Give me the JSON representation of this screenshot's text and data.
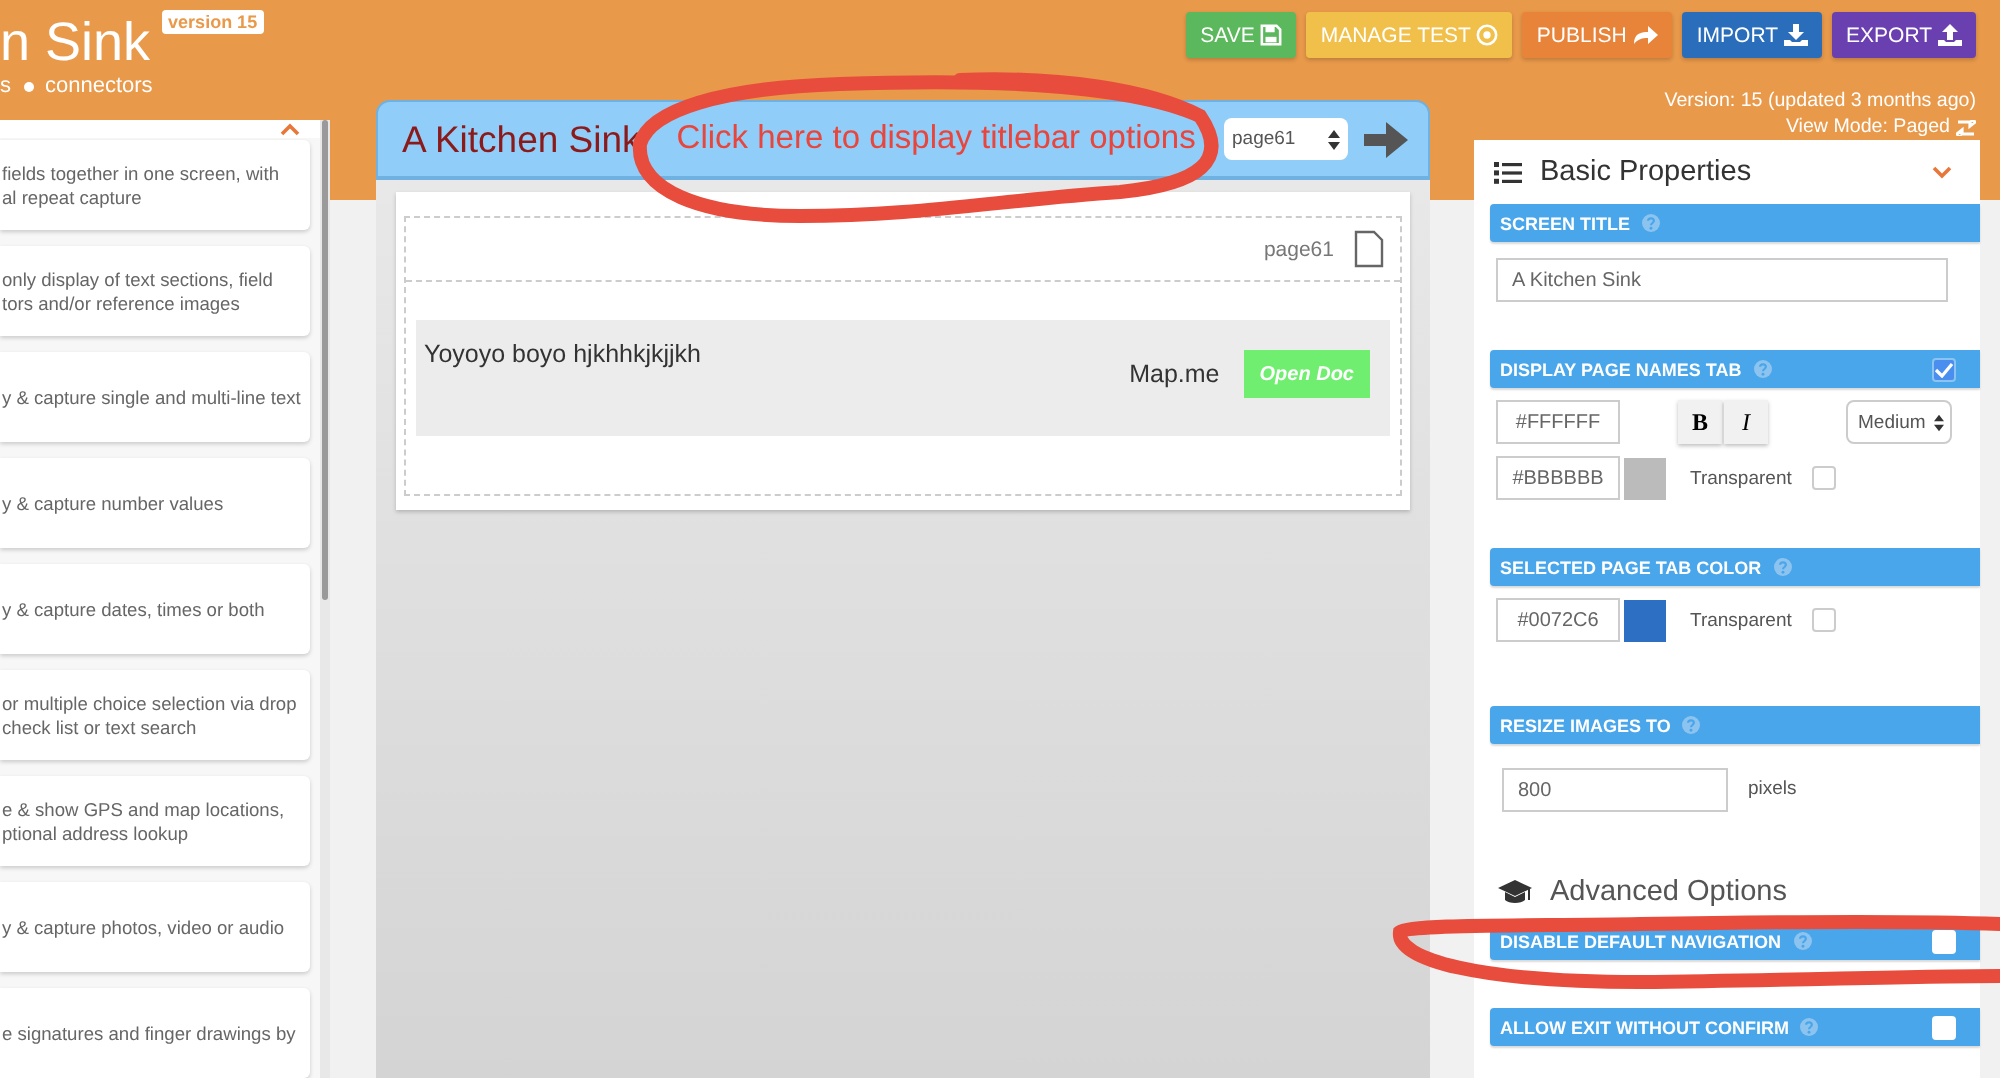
{
  "header": {
    "title": "n Sink",
    "version_badge": "version 15",
    "breadcrumb": [
      {
        "label": "s"
      },
      {
        "label": "connectors"
      }
    ]
  },
  "toolbar": [
    {
      "label": "SAVE",
      "kind": "save",
      "color": "#5cb85c"
    },
    {
      "label": "MANAGE TEST",
      "kind": "target",
      "color": "#f0c04a"
    },
    {
      "label": "PUBLISH",
      "kind": "share",
      "color": "#e8843a"
    },
    {
      "label": "IMPORT",
      "kind": "download",
      "color": "#2a6ebb"
    },
    {
      "label": "EXPORT",
      "kind": "upload",
      "color": "#6a3fb0"
    }
  ],
  "version_info": "Version: 15 (updated 3 months ago)",
  "view_mode": "View Mode: Paged",
  "components_panel": {
    "expanded": true,
    "items": [
      {
        "description": "fields together in one screen, with\nal repeat capture"
      },
      {
        "description": "only display of text sections, field\ntors and/or reference images"
      },
      {
        "description": "y & capture single and multi-line text"
      },
      {
        "description": "y & capture number values"
      },
      {
        "description": "y & capture dates, times or both"
      },
      {
        "description": "or multiple choice selection via drop\ncheck list or text search"
      },
      {
        "description": "e & show GPS and map locations,\nptional address lookup"
      },
      {
        "description": "y & capture photos, video or audio"
      },
      {
        "description": "e signatures and finger drawings by"
      }
    ]
  },
  "screen": {
    "title": "A Kitchen Sink",
    "titlebar_hint": "Click here to display titlebar options",
    "page_select": "page61",
    "page_label": "page61",
    "text": "Yoyoyo boyo hjkhhkjkjjkh",
    "link": "Map.me",
    "button": "Open Doc"
  },
  "properties": {
    "title": "Basic Properties",
    "expanded": true,
    "sections": [
      {
        "kind": "text",
        "label": "SCREEN TITLE",
        "value": "A Kitchen Sink"
      },
      {
        "kind": "page_names",
        "label": "DISPLAY PAGE NAMES TAB",
        "checked": true,
        "text_color": "#FFFFFF",
        "bold": "B",
        "italic": "I",
        "size": "Medium",
        "background": "#BBBBBB",
        "color": "#bbbbbb",
        "transparent_label": "Transparent",
        "transparent": false
      },
      {
        "kind": "color",
        "label": "SELECTED PAGE TAB COLOR",
        "value": "#0072C6",
        "color": "#2d6fc2",
        "transparent_label": "Transparent",
        "transparent": false
      },
      {
        "kind": "number",
        "label": "RESIZE IMAGES TO",
        "value": "800",
        "unit": "pixels"
      }
    ]
  },
  "advanced": {
    "title": "Advanced Options",
    "toggles": [
      {
        "label": "DISABLE DEFAULT NAVIGATION",
        "checked": false
      },
      {
        "label": "ALLOW EXIT WITHOUT CONFIRM",
        "checked": false
      }
    ]
  },
  "annotations": [
    {
      "kind": "loop"
    },
    {
      "kind": "loop"
    }
  ]
}
